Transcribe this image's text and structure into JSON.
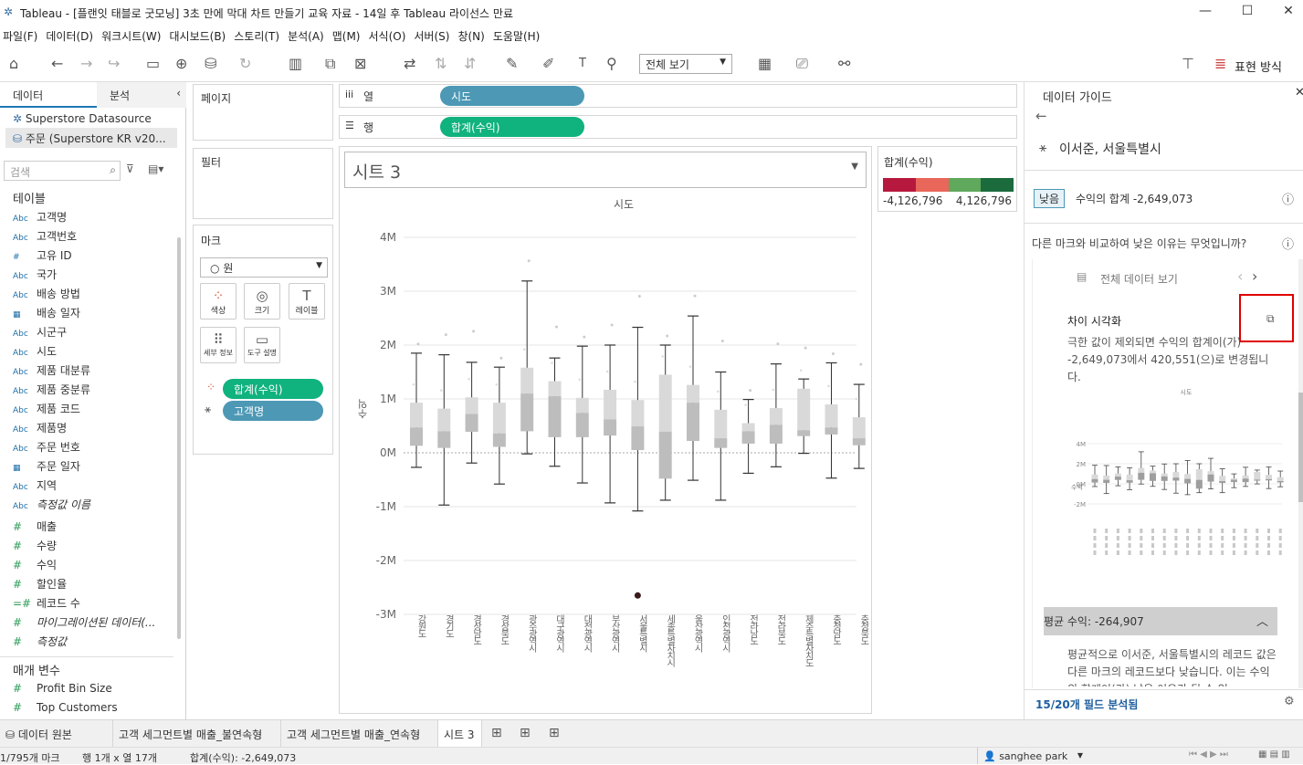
{
  "window": {
    "title": "Tableau - [플랜잇 태블로 굿모닝] 3초 만에 막대 차트 만들기 교육 자료 - 14일 후 Tableau 라이선스 만료"
  },
  "menu": [
    "파일(F)",
    "데이터(D)",
    "워크시트(W)",
    "대시보드(B)",
    "스토리(T)",
    "분석(A)",
    "맵(M)",
    "서식(O)",
    "서버(S)",
    "창(N)",
    "도움말(H)"
  ],
  "toolbar": {
    "view_select": "전체 보기",
    "show_me": "표현 방식"
  },
  "left": {
    "tab_data": "데이터",
    "tab_analysis": "분석",
    "datasources": [
      "Superstore Datasource",
      "주문 (Superstore KR v20..."
    ],
    "search_placeholder": "검색",
    "tables_header": "테이블",
    "dimensions": [
      {
        "icon": "Abc",
        "name": "고객명"
      },
      {
        "icon": "Abc",
        "name": "고객번호"
      },
      {
        "icon": "#",
        "name": "고유 ID"
      },
      {
        "icon": "Abc",
        "name": "국가"
      },
      {
        "icon": "Abc",
        "name": "배송 방법"
      },
      {
        "icon": "▦",
        "name": "배송 일자"
      },
      {
        "icon": "Abc",
        "name": "시군구"
      },
      {
        "icon": "Abc",
        "name": "시도"
      },
      {
        "icon": "Abc",
        "name": "제품 대분류"
      },
      {
        "icon": "Abc",
        "name": "제품 중분류"
      },
      {
        "icon": "Abc",
        "name": "제품 코드"
      },
      {
        "icon": "Abc",
        "name": "제품명"
      },
      {
        "icon": "Abc",
        "name": "주문 번호"
      },
      {
        "icon": "▦",
        "name": "주문 일자"
      },
      {
        "icon": "Abc",
        "name": "지역"
      },
      {
        "icon": "Abc",
        "name": "측정값 이름"
      }
    ],
    "measures": [
      {
        "icon": "#",
        "name": "매출"
      },
      {
        "icon": "#",
        "name": "수량"
      },
      {
        "icon": "#",
        "name": "수익"
      },
      {
        "icon": "#",
        "name": "할인율"
      },
      {
        "icon": "=#",
        "name": "레코드 수"
      },
      {
        "icon": "#",
        "name": "마이그레이션된 데이터(..."
      },
      {
        "icon": "#",
        "name": "측정값"
      }
    ],
    "params_header": "매개 변수",
    "params": [
      "Profit Bin Size",
      "Top Customers"
    ]
  },
  "shelves": {
    "pages": "페이지",
    "filters": "필터",
    "marks": "마크",
    "mark_type": "원",
    "mark_buttons": [
      "색상",
      "크기",
      "레이블",
      "세부 정보",
      "도구 설명"
    ],
    "mark_pills": [
      "합계(수익)",
      "고객명"
    ],
    "columns_label": "열",
    "rows_label": "행",
    "columns_pill": "시도",
    "rows_pill": "합계(수익)"
  },
  "sheet": {
    "title": "시트 3",
    "header": "시도",
    "ylabel": "수익"
  },
  "legend": {
    "title": "합계(수익)",
    "min": "-4,126,796",
    "max": "4,126,796"
  },
  "chart_data": {
    "type": "box",
    "title": "시트 3",
    "xlabel": "시도",
    "ylabel": "수익",
    "ylim": [
      -3200000,
      4300000
    ],
    "yticks": [
      "4M",
      "3M",
      "2M",
      "1M",
      "0M",
      "-1M",
      "-2M",
      "-3M"
    ],
    "ytick_values": [
      4000000,
      3000000,
      2000000,
      1000000,
      0,
      -1000000,
      -2000000,
      -3000000
    ],
    "categories": [
      "강원도",
      "경기도",
      "경상남도",
      "경상북도",
      "광주광역시",
      "대구광역시",
      "대전광역시",
      "부산광역시",
      "서울특별시",
      "세종특별자치시",
      "울산광역시",
      "인천광역시",
      "전라남도",
      "전라북도",
      "제주특별자치도",
      "충청남도",
      "충청북도"
    ],
    "boxes": [
      {
        "lo": -270000,
        "q1": 130000,
        "med": 470000,
        "q3": 930000,
        "hi": 1850000
      },
      {
        "lo": -970000,
        "q1": 90000,
        "med": 400000,
        "q3": 820000,
        "hi": 1820000
      },
      {
        "lo": -190000,
        "q1": 390000,
        "med": 720000,
        "q3": 1030000,
        "hi": 1680000
      },
      {
        "lo": -580000,
        "q1": 110000,
        "med": 360000,
        "q3": 930000,
        "hi": 1590000
      },
      {
        "lo": -20000,
        "q1": 400000,
        "med": 1100000,
        "q3": 1580000,
        "hi": 3190000
      },
      {
        "lo": -250000,
        "q1": 290000,
        "med": 1050000,
        "q3": 1330000,
        "hi": 1760000
      },
      {
        "lo": -560000,
        "q1": 290000,
        "med": 740000,
        "q3": 1020000,
        "hi": 1980000
      },
      {
        "lo": -930000,
        "q1": 320000,
        "med": 620000,
        "q3": 1170000,
        "hi": 2000000
      },
      {
        "lo": -1080000,
        "q1": 50000,
        "med": 490000,
        "q3": 980000,
        "hi": 2330000
      },
      {
        "lo": -880000,
        "q1": -480000,
        "med": 390000,
        "q3": 1450000,
        "hi": 2000000
      },
      {
        "lo": -510000,
        "q1": 220000,
        "med": 930000,
        "q3": 1260000,
        "hi": 2540000
      },
      {
        "lo": -880000,
        "q1": 90000,
        "med": 270000,
        "q3": 800000,
        "hi": 1500000
      },
      {
        "lo": -380000,
        "q1": 170000,
        "med": 400000,
        "q3": 550000,
        "hi": 990000
      },
      {
        "lo": -260000,
        "q1": 170000,
        "med": 520000,
        "q3": 830000,
        "hi": 1650000
      },
      {
        "lo": -10000,
        "q1": 310000,
        "med": 420000,
        "q3": 1190000,
        "hi": 1370000
      },
      {
        "lo": -470000,
        "q1": 340000,
        "med": 470000,
        "q3": 900000,
        "hi": 1670000
      },
      {
        "lo": -290000,
        "q1": 140000,
        "med": 270000,
        "q3": 660000,
        "hi": 1270000
      }
    ],
    "highlight": {
      "category": "서울특별시",
      "value": -2649073
    }
  },
  "guide": {
    "title": "데이터 가이드",
    "mark": "이서준, 서울특별시",
    "badge": "낮음",
    "summary": "수익의 합계 -2,649,073",
    "question": "다른 마크와 비교하여 낮은 이유는 무엇입니까?",
    "view_all": "전체 데이터 보기",
    "viz_title": "차이 시각화",
    "desc": "극한 값이 제외되면 수익의 합계이(가) -2,649,073에서 420,551(으)로 변경됩니다.",
    "mini_header": "시도",
    "mini_ylabel": "수익",
    "mini_yticks": [
      "4M",
      "2M",
      "0M",
      "-2M"
    ],
    "avg": "평균 수익: -264,907",
    "avg_desc": "평균적으로 이서준, 서울특별시의 레코드 값은 다른 마크의 레코드보다 낮습니다. 이는 수익의 합계이(가) 낮은 이유가 될 수 있",
    "footer": "15/20개 필드 분석됨"
  },
  "tabs": [
    "데이터 원본",
    "고객 세그먼트별 매출_불연속형",
    "고객 세그먼트별 매출_연속형",
    "시트 3"
  ],
  "status": {
    "marks": "1/795개 마크",
    "rows": "행 1개 x 열 17개",
    "sum": "합계(수익): -2,649,073",
    "user": "sanghee park"
  },
  "colors": {
    "accent_blue": "#4c98b5",
    "accent_green": "#10b27e",
    "legend_neg": "#b7193e",
    "legend_pos": "#1b6b3d",
    "highlight_red": "#e00000"
  }
}
